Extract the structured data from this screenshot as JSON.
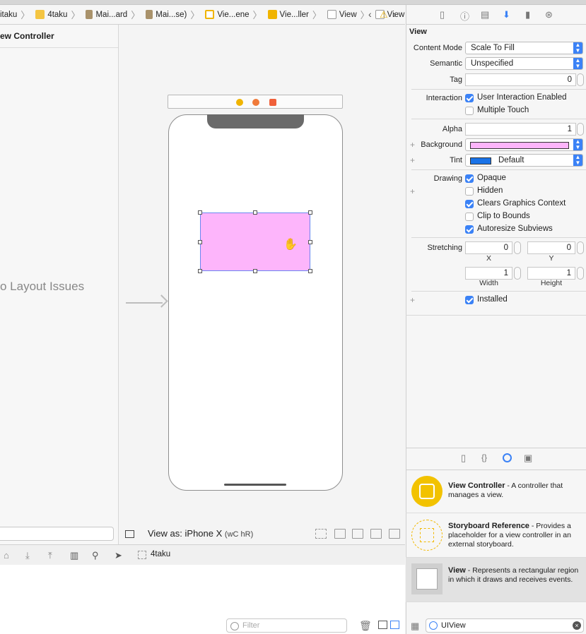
{
  "breadcrumbs": [
    {
      "label": "itaku",
      "icon": "project-icon"
    },
    {
      "label": "4taku",
      "icon": "folder-icon"
    },
    {
      "label": "Mai...ard",
      "icon": "storyboard-file-icon"
    },
    {
      "label": "Mai...se)",
      "icon": "storyboard-file-icon"
    },
    {
      "label": "Vie...ene",
      "icon": "scene-icon"
    },
    {
      "label": "Vie...ller",
      "icon": "view-controller-icon"
    },
    {
      "label": "View",
      "icon": "view-icon"
    },
    {
      "label": "View",
      "icon": "view-icon"
    }
  ],
  "outline": {
    "title": "ew Controller",
    "status": "o Layout Issues"
  },
  "canvas": {
    "view_as": "View as: iPhone X",
    "size_class": "(wC hR)",
    "selected_view_color": "#fdb5fb"
  },
  "debug": {
    "target": "4taku",
    "console_filter_placeholder": "Filter"
  },
  "inspector": {
    "section_title": "View",
    "content_mode": {
      "label": "Content Mode",
      "value": "Scale To Fill"
    },
    "semantic": {
      "label": "Semantic",
      "value": "Unspecified"
    },
    "tag": {
      "label": "Tag",
      "value": "0"
    },
    "interaction": {
      "label": "Interaction",
      "user_interaction": {
        "label": "User Interaction Enabled",
        "checked": true
      },
      "multiple_touch": {
        "label": "Multiple Touch",
        "checked": false
      }
    },
    "alpha": {
      "label": "Alpha",
      "value": "1"
    },
    "background": {
      "label": "Background",
      "color": "#fdb5fb"
    },
    "tint": {
      "label": "Tint",
      "value": "Default",
      "color": "#1a73e8"
    },
    "drawing": {
      "label": "Drawing",
      "opaque": {
        "label": "Opaque",
        "checked": true
      },
      "hidden": {
        "label": "Hidden",
        "checked": false
      },
      "clears": {
        "label": "Clears Graphics Context",
        "checked": true
      },
      "clip": {
        "label": "Clip to Bounds",
        "checked": false
      },
      "autoresize": {
        "label": "Autoresize Subviews",
        "checked": true
      }
    },
    "stretching": {
      "label": "Stretching",
      "x": "0",
      "y": "0",
      "width": "1",
      "height": "1",
      "x_label": "X",
      "y_label": "Y",
      "width_label": "Width",
      "height_label": "Height"
    },
    "installed": {
      "label": "Installed",
      "checked": true
    }
  },
  "library": {
    "items": [
      {
        "title": "View Controller",
        "desc": " - A controller that manages a view."
      },
      {
        "title": "Storyboard Reference",
        "desc": " - Provides a placeholder for a view controller in an external storyboard."
      },
      {
        "title": "View",
        "desc": " - Represents a rectangular region in which it draws and receives events."
      }
    ],
    "filter_value": "UIView"
  }
}
